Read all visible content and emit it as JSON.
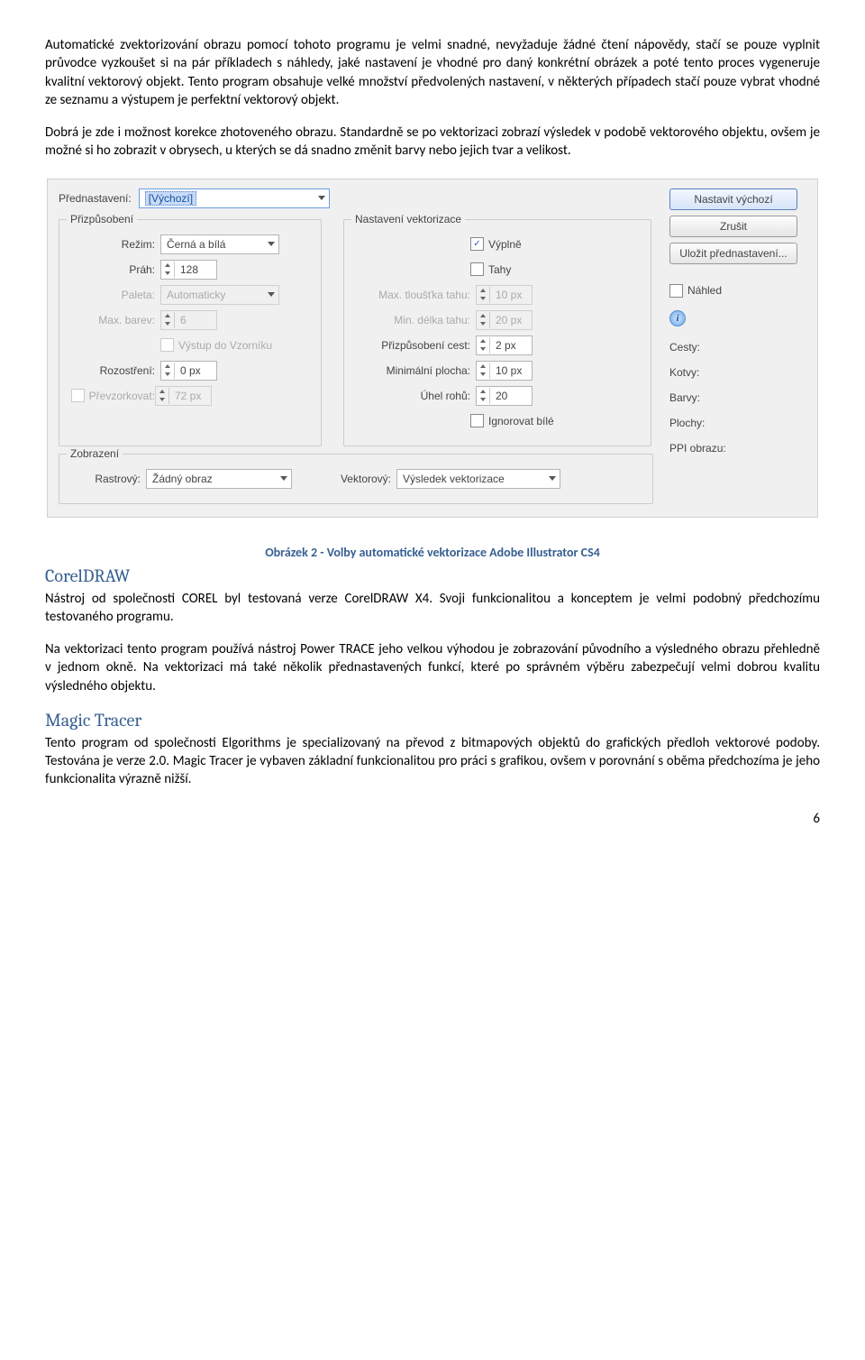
{
  "para1": "Automatické zvektorizování obrazu pomocí tohoto programu je velmi snadné, nevyžaduje žádné čtení nápovědy, stačí se pouze vyplnit průvodce vyzkoušet si na pár příkladech s náhledy, jaké nastavení je vhodné pro daný konkrétní obrázek a poté tento proces vygeneruje kvalitní vektorový objekt. Tento program obsahuje velké množství předvolených nastavení, v některých případech stačí pouze vybrat vhodné ze seznamu a výstupem je perfektní vektorový objekt.",
  "para2": "Dobrá je zde i možnost korekce zhotoveného obrazu. Standardně se po vektorizaci zobrazí výsledek v podobě vektorového objektu, ovšem je možné si ho zobrazit v obrysech, u kterých se dá snadno změnit barvy nebo jejich tvar a velikost.",
  "dialog": {
    "preset_label": "Přednastavení:",
    "preset_value": "[Výchozí]",
    "btn_default": "Nastavit výchozí",
    "btn_cancel": "Zrušit",
    "btn_save_preset": "Uložit přednastavení...",
    "group_adjust": "Přizpůsobení",
    "group_trace": "Nastavení vektorizace",
    "group_view": "Zobrazení",
    "mode_label": "Režim:",
    "mode_value": "Černá a bílá",
    "threshold_label": "Práh:",
    "threshold_value": "128",
    "palette_label": "Paleta:",
    "palette_value": "Automaticky",
    "maxcolors_label": "Max. barev:",
    "maxcolors_value": "6",
    "output_swatch": "Výstup do Vzorníku",
    "blur_label": "Rozostření:",
    "blur_value": "0 px",
    "resample_label": "Převzorkovat:",
    "resample_value": "72 px",
    "fills": "Výplně",
    "strokes": "Tahy",
    "max_stroke_label": "Max. tloušťka tahu:",
    "max_stroke_value": "10 px",
    "min_stroke_label": "Min. délka tahu:",
    "min_stroke_value": "20 px",
    "path_fit_label": "Přizpůsobení cest:",
    "path_fit_value": "2 px",
    "min_area_label": "Minimální plocha:",
    "min_area_value": "10 px",
    "corner_label": "Úhel rohů:",
    "corner_value": "20",
    "ignore_white": "Ignorovat bílé",
    "raster_label": "Rastrový:",
    "raster_value": "Žádný obraz",
    "vector_label": "Vektorový:",
    "vector_value": "Výsledek vektorizace",
    "preview": "Náhled",
    "stats": {
      "paths": "Cesty:",
      "anchors": "Kotvy:",
      "colors": "Barvy:",
      "areas": "Plochy:",
      "ppi": "PPI obrazu:"
    }
  },
  "caption": "Obrázek 2 - Volby automatické vektorizace Adobe Illustrator CS4",
  "h_corel": "CorelDRAW",
  "corel_p1": "Nástroj od společnosti COREL byl testovaná verze CorelDRAW X4. Svoji funkcionalitou a konceptem je velmi podobný předchozímu testovaného programu.",
  "corel_p2": "Na vektorizaci tento program používá nástroj Power TRACE jeho velkou výhodou je zobrazování původního a výsledného obrazu přehledně v jednom okně.  Na vektorizaci má také několik přednastavených funkcí, které po správném výběru zabezpečují velmi dobrou kvalitu výsledného objektu.",
  "h_magic": "Magic Tracer",
  "magic_p": "Tento program od společnosti Elgorithms je specializovaný na převod z bitmapových objektů do grafických předloh vektorové podoby. Testována je verze 2.0. Magic Tracer je vybaven základní funkcionalitou pro práci s grafikou, ovšem v porovnání s oběma předchozíma je jeho funkcionalita výrazně nižší.",
  "page_num": "6"
}
